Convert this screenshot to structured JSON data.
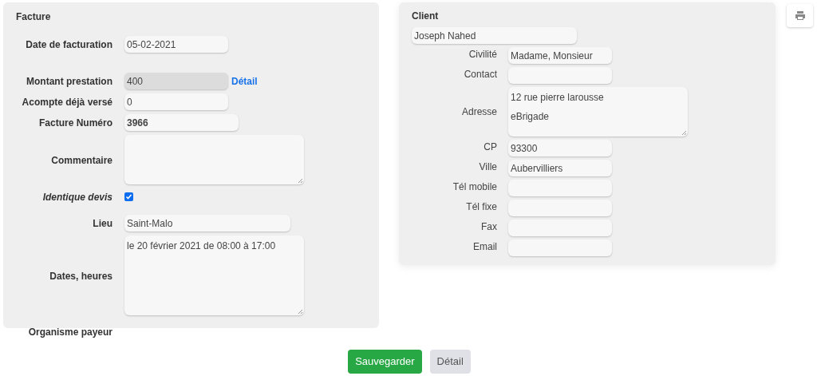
{
  "facture": {
    "title": "Facture",
    "rows": [
      {
        "kind": "input",
        "label": "Date de facturation",
        "value": "05-02-2021",
        "disabled": false,
        "bold": false
      },
      {
        "kind": "input",
        "label": "Montant prestation",
        "value": "400",
        "disabled": true,
        "bold": false,
        "link": "Détail"
      },
      {
        "kind": "input",
        "label": "Acompte déjà versé",
        "value": "0",
        "disabled": false,
        "bold": false
      },
      {
        "kind": "input",
        "label": "Facture Numéro",
        "value": "3966",
        "disabled": false,
        "bold": true
      },
      {
        "kind": "area",
        "label": "Commentaire",
        "lines": []
      },
      {
        "kind": "checkbox",
        "label": "Identique devis",
        "checked": true
      },
      {
        "kind": "input",
        "label": "Lieu",
        "value": "Saint-Malo",
        "disabled": false,
        "bold": false
      },
      {
        "kind": "area",
        "label": "Dates, heures",
        "lines": [
          "le 20 février 2021 de 08:00 à 17:00"
        ]
      },
      {
        "kind": "none",
        "label": "Organisme payeur"
      }
    ]
  },
  "client": {
    "title": "Client",
    "name": "Joseph Nahed",
    "rows": [
      {
        "kind": "input",
        "label": "Civilité",
        "value": "Madame, Monsieur"
      },
      {
        "kind": "input",
        "label": "Contact"
      },
      {
        "kind": "area",
        "label": "Adresse",
        "lines": [
          "12 rue pierre larousse",
          "eBrigade"
        ]
      },
      {
        "kind": "input",
        "label": "CP",
        "value": "93300"
      },
      {
        "kind": "input",
        "label": "Ville",
        "value": "Aubervilliers"
      },
      {
        "kind": "input",
        "label": "Tél mobile"
      },
      {
        "kind": "input",
        "label": "Tél fixe"
      },
      {
        "kind": "input",
        "label": "Fax"
      },
      {
        "kind": "input",
        "label": "Email"
      }
    ]
  },
  "buttons": [
    {
      "kind": "primary",
      "label": "Sauvegarder"
    },
    {
      "kind": "secondary",
      "label": "Détail"
    }
  ]
}
